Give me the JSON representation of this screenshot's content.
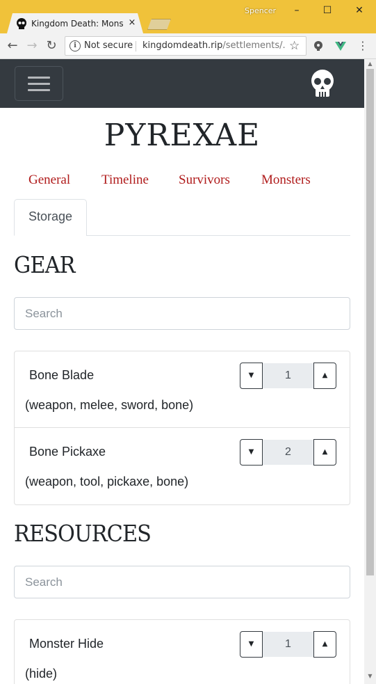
{
  "browser": {
    "tab_title": "Kingdom Death: Monster",
    "tab_close": "×",
    "profile_name": "Spencer",
    "window_controls": {
      "minimize": "–",
      "maximize": "☐",
      "close": "✕"
    },
    "back": "←",
    "forward": "→",
    "reload": "↻",
    "security_label": "Not secure",
    "url_host": "kingdomdeath.rip",
    "url_path": "/settlements/...",
    "star": "☆",
    "menu": "⋮",
    "icons": [
      "skull-favicon",
      "info-icon",
      "star-icon",
      "lightbulb-extension-icon",
      "vue-extension-icon",
      "kebab-menu-icon"
    ]
  },
  "navbar": {
    "background": "#343a40",
    "icons": [
      "hamburger-icon",
      "skull-logo-icon"
    ]
  },
  "page": {
    "title": "PYREXAE",
    "link_color": "#b01b1b",
    "nav": [
      "General",
      "Timeline",
      "Survivors",
      "Monsters"
    ],
    "active_tab": "Storage"
  },
  "gear": {
    "heading": "GEAR",
    "search_placeholder": "Search",
    "items": [
      {
        "name": "Bone Blade",
        "quantity": "1",
        "tags": "(weapon, melee, sword, bone)"
      },
      {
        "name": "Bone Pickaxe",
        "quantity": "2",
        "tags": "(weapon, tool, pickaxe, bone)"
      }
    ]
  },
  "resources": {
    "heading": "RESOURCES",
    "search_placeholder": "Search",
    "items": [
      {
        "name": "Monster Hide",
        "quantity": "1",
        "tags": "(hide)"
      }
    ]
  }
}
